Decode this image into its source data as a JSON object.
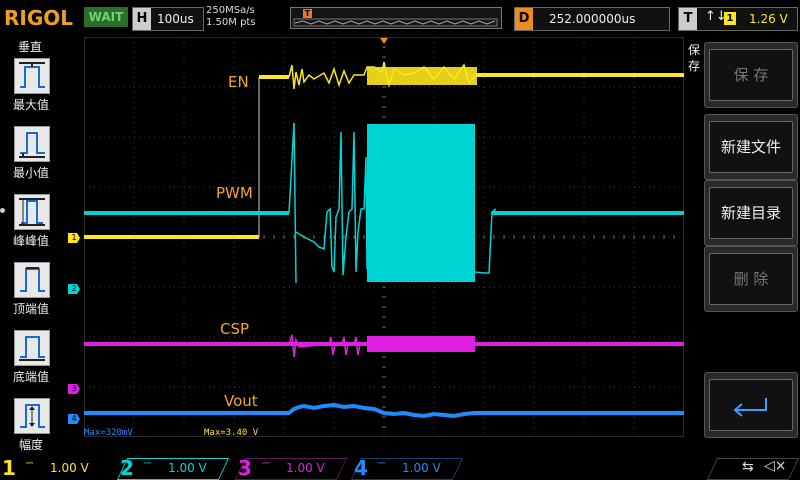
{
  "header": {
    "logo": "RIGOL",
    "run_status": "WAIT",
    "horizontal": {
      "label": "H",
      "value": "100us"
    },
    "sample_rate": "250MSa/s",
    "memory_points": "1.50M pts",
    "trigger_marker": "T",
    "delay": {
      "label": "D",
      "value": "252.000000us"
    },
    "trigger": {
      "label": "T",
      "edge": "↑↓",
      "source": "1",
      "level": "1.26 V"
    }
  },
  "left_panel": {
    "title": "垂直",
    "items": [
      {
        "label": "最大值",
        "icon": "max-waveform-icon"
      },
      {
        "label": "最小值",
        "icon": "min-waveform-icon"
      },
      {
        "label": "峰峰值",
        "icon": "peak-peak-waveform-icon"
      },
      {
        "label": "顶端值",
        "icon": "top-waveform-icon"
      },
      {
        "label": "底端值",
        "icon": "base-waveform-icon"
      },
      {
        "label": "幅度",
        "icon": "amplitude-waveform-icon"
      }
    ]
  },
  "right_panel": {
    "title": "保存",
    "buttons": [
      {
        "label": "保 存",
        "enabled": false
      },
      {
        "label": "新建文件",
        "enabled": true
      },
      {
        "label": "新建目录",
        "enabled": true
      },
      {
        "label": "删 除",
        "enabled": false
      },
      {
        "label": "",
        "icon": "return-arrow-icon",
        "enabled": true
      }
    ]
  },
  "waveform": {
    "signal_labels": [
      {
        "text": "EN",
        "color": "#f5a623"
      },
      {
        "text": "PWM",
        "color": "#f5a623"
      },
      {
        "text": "CSP",
        "color": "#f5a623"
      },
      {
        "text": "Vout",
        "color": "#f5a623"
      }
    ],
    "channel_markers": [
      "1",
      "2",
      "3",
      "4"
    ],
    "measurements": {
      "ch4_max": "Max=320mV",
      "ch1_max": "Max=3.40 V"
    }
  },
  "channels": [
    {
      "num": "1",
      "scale": "1.00 V",
      "color": "#ffe51e"
    },
    {
      "num": "2",
      "scale": "1.00 V",
      "color": "#00d5d5"
    },
    {
      "num": "3",
      "scale": "1.00 V",
      "color": "#e020e0"
    },
    {
      "num": "4",
      "scale": "1.00 V",
      "color": "#1e8cff"
    }
  ],
  "status_icons": [
    "usb-icon",
    "speaker-muted-icon"
  ],
  "colors": {
    "ch1": "#ffe51e",
    "ch2": "#00d5d5",
    "ch3": "#e020e0",
    "ch4": "#1e8cff",
    "trigger": "#f08c1e",
    "label": "#f5a623"
  }
}
